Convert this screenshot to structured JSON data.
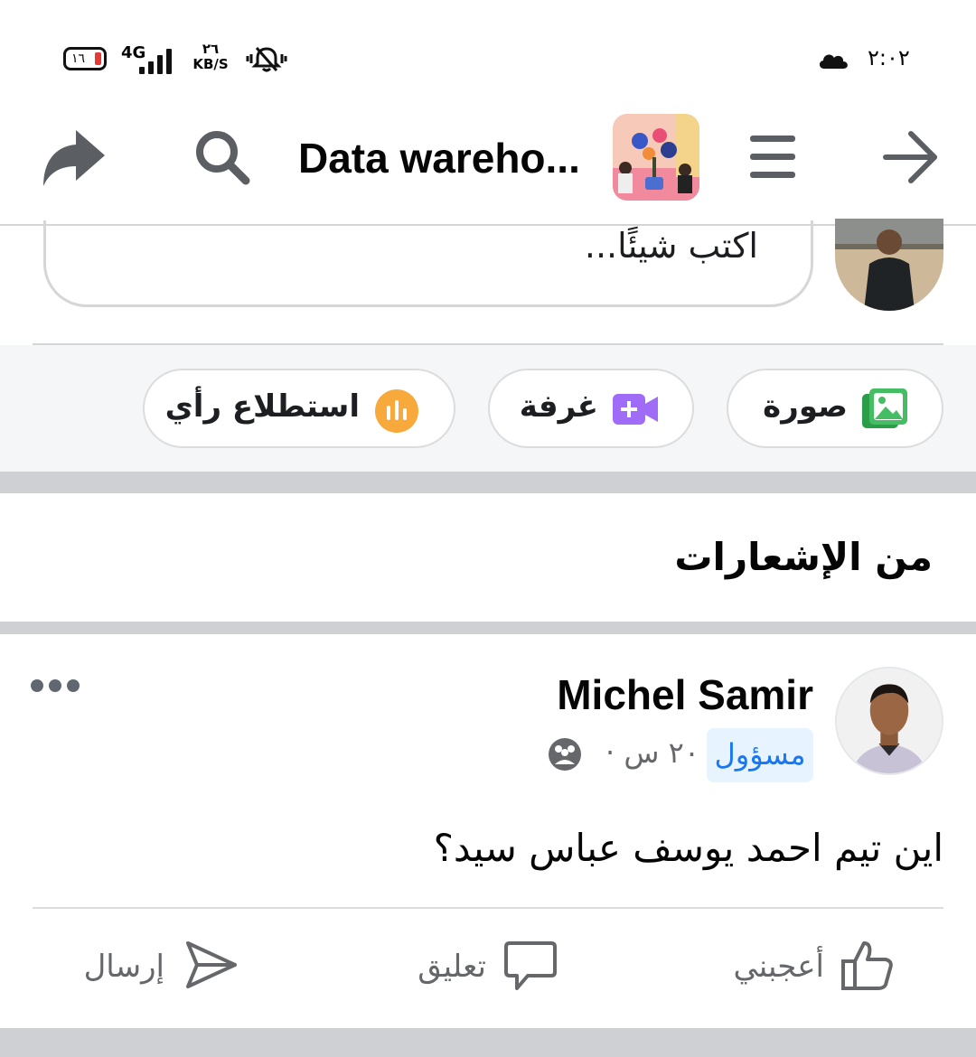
{
  "status_bar": {
    "battery": "١٦",
    "network": "4G",
    "speed_value": "٢٦",
    "speed_unit": "KB/S",
    "time": "٢:٠٢"
  },
  "header": {
    "title": "Data wareho..."
  },
  "composer": {
    "placeholder": "اكتب شيئًا..."
  },
  "quick_actions": [
    {
      "label": "صورة",
      "icon": "photo-icon",
      "color": "#45bd62"
    },
    {
      "label": "غرفة",
      "icon": "video-plus-icon",
      "color": "#a06bf6"
    },
    {
      "label": "استطلاع رأي",
      "icon": "poll-icon",
      "color": "#f7a93b"
    }
  ],
  "section": {
    "title": "من الإشعارات"
  },
  "post": {
    "author": "Michel Samir",
    "role": "مسؤول",
    "time": "٢٠ س ·",
    "text": "اين تيم احمد يوسف عباس سيد؟",
    "actions": {
      "like": "أعجبني",
      "comment": "تعليق",
      "send": "إرسال"
    }
  },
  "colors": {
    "accent": "#1877f2",
    "badge_bg": "#e7f3ff",
    "separator": "#ced0d4",
    "strip_bg": "#f5f6f7"
  }
}
